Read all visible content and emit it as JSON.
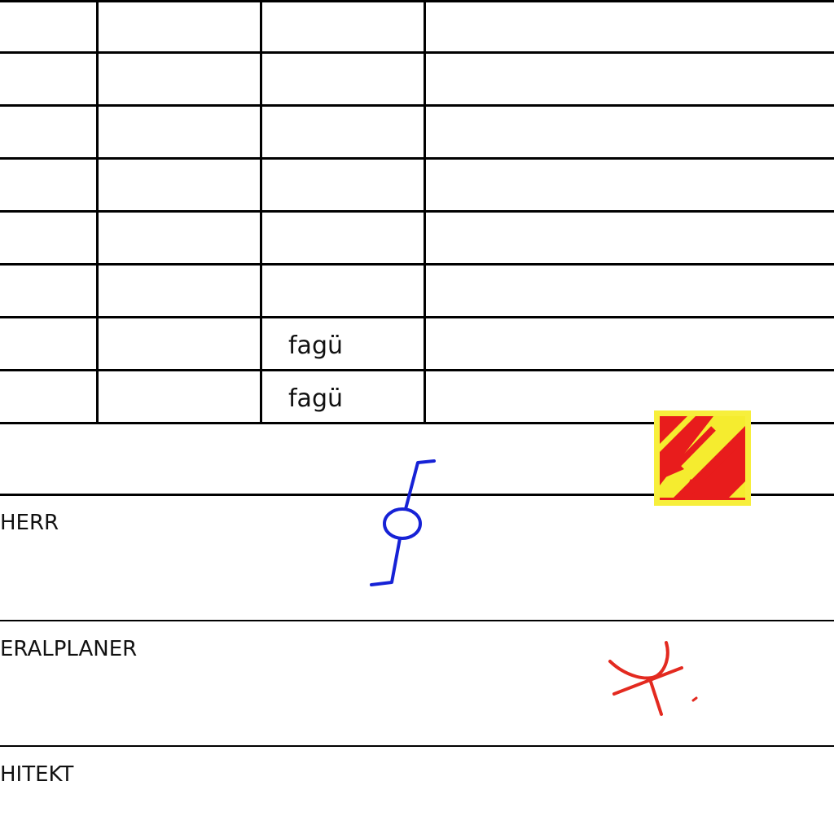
{
  "table": {
    "rows": [
      {
        "col3": ""
      },
      {
        "col3": ""
      },
      {
        "col3": ""
      },
      {
        "col3": ""
      },
      {
        "col3": ""
      },
      {
        "col3": ""
      },
      {
        "col3": "fagü"
      },
      {
        "col3": "fagü"
      }
    ]
  },
  "roles": [
    {
      "label": "HERR"
    },
    {
      "label": "ERALPLANER"
    },
    {
      "label": "HITEKT"
    }
  ],
  "stamp": {
    "icon": "hatched-arrows-icon",
    "colors": {
      "fill": "#e81c1c",
      "border": "#f7ef3c",
      "stripes": "#f5ec2f"
    }
  },
  "signatures": [
    {
      "icon": "blue-signature-icon",
      "color": "#1622d6"
    },
    {
      "icon": "red-signature-icon",
      "color": "#e32a20"
    }
  ]
}
